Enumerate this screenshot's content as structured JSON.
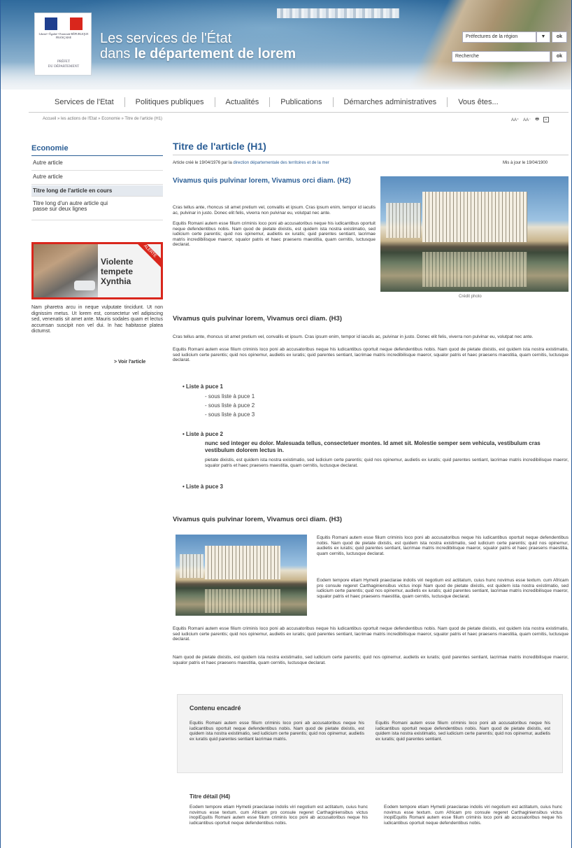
{
  "header": {
    "logo_rf": "Liberté • Égalité • Fraternité RÉPUBLIQUE FRANÇAISE",
    "logo_pref_line1": "PRÉFET",
    "logo_pref_line2": "DU DÉPARTEMENT",
    "title_line1": "Les services de l'État",
    "title_line2_prefix": "dans ",
    "title_line2_bold": "le département de lorem",
    "pref_select_value": "Préfectures de la région",
    "pref_ok": "ok",
    "search_placeholder": "Recherche",
    "search_ok": "ok"
  },
  "nav": [
    "Services de l'Etat",
    "Politiques publiques",
    "Actualités",
    "Publications",
    "Démarches administratives",
    "Vous êtes..."
  ],
  "breadcrumb": "Accueil » les actions de l'Etat » Economie » Titre de l'article (H1)",
  "tools": {
    "font_bigger": "AA⁺",
    "font_smaller": "AA⁻",
    "print_icon": "🖶",
    "share_icon": "+"
  },
  "sidebar": {
    "title": "Economie",
    "items": [
      "Autre article",
      "Autre article",
      "Titre long de l'article en cours",
      "Titre long d'un autre article qui passe sur deux lignes"
    ],
    "banner_line1": "Violente",
    "banner_line2": "tempete",
    "banner_line3": "Xynthia",
    "banner_ribbon": "ALERTE",
    "text": "Nam pharetra arcu in neque vulputate tincidunt. Ut non dignissim metus. Ut lorem est, consectetur vel adipiscing sed, venenatis sit amet ante. Mauris sodales quam et lectus accumsan suscipit non vel dui. In hac habitasse platea dictumst.",
    "link": "> Voir l'article"
  },
  "article": {
    "h1": "Titre de l'article (H1)",
    "meta_prefix": "Article créé le 19/04/1976 par la ",
    "meta_link": "direction départementale des territoires et de la mer",
    "updated": "Mis à jour le 19/04/1900",
    "h2": "Vivamus quis pulvinar lorem, Vivamus orci diam. (H2)",
    "p1": "Cras tellus ante, rhoncus sit amet pretium vel, convallis et ipsum. Cras ipsum enim, tempor id iaculis ac, pulvinar in justo. Donec elit felis, viverra non pulvinar eu, volutpat nec ante.",
    "p2": "Equitis Romani autem esse filium criminis loco poni ab accusatoribus neque his iudicantibus oportuit neque defendentibus nobis. Nam quod de pietate dixistis, est quidem ista nostra existimatio, sed iudicium certe parentis; quid nos opinemur, audietis ex iuratis; quid parentes sentiant, lacrimae matris incredibilisque maeror, squalor patris et haec praesens maestitia, quam cernitis, luctusque declarat.",
    "photo_credit": "Crédit photo",
    "h3a": "Vivamus quis pulvinar lorem, Vivamus orci diam. (H3)",
    "p3": "Cras tellus ante, rhoncus sit amet pretium vel, convallis et ipsum. Cras ipsum enim, tempor id iaculis ac, pulvinar in justo. Donec elit felis, viverra non pulvinar eu, volutpat nec ante.",
    "p4": "Equitis Romani autem esse filium criminis loco poni ab accusatoribus neque his iudicantibus oportuit neque defendentibus nobis. Nam quod de pietate dixistis, est quidem ista nostra existimatio, sed iudicium certe parentis; quid nos opinemur, audietis ex iuratis; quid parentes sentiant, lacrimae matris incredibilisque maeror, squalor patris et haec praesens maestitia, quam cernitis, luctusque declarat.",
    "list1": "• Liste à puce 1",
    "sub1": "- sous liste à puce 1",
    "sub2": "- sous liste à puce 2",
    "sub3": "- sous liste à puce 3",
    "list2": "• Liste à puce 2",
    "list2_bold": "nunc sed integer eu dolor. Malesuada tellus, consectetuer montes. Id amet sit. Molestie semper sem vehicula, vestibulum cras vestibulum dolorem lectus in.",
    "list2_text": "pietate dixistis, est quidem ista nostra existimatio, sed iudicium certe parentis; quid nos opinemur, audietis ex iuratis; quid parentes sentiant, lacrimae matris incredibilisque maeror, squalor patris et haec praesens maestitia, quam cernitis, luctusque declarat.",
    "list3": "• Liste à puce 3",
    "h3b": "Vivamus quis pulvinar lorem, Vivamus orci diam. (H3)",
    "p5": "Equitis Romani autem esse filium criminis loco poni ab accusatoribus neque his iudicantibus oportuit neque defendentibus nobis. Nam quod de pietate dixistis, est quidem ista nostra existimatio, sed iudicium certe parentis; quid nos opinemur, audietis ex iuratis; quid parentes sentiant, lacrimae matris incredibilisque maeror, squalor patris et haec praesens maestitia, quam cernitis, luctusque declarat.",
    "p6": "Eodem tempore etiam Hymetii praeclarae indolis viri negotium est actitatum, cuius hunc novimus esse textum. cum Africam pro consule regeret Carthaginiensibus victus inopi Nam quod de pietate dixistis, est quidem ista nostra existimatio, sed iudicium certe parentis; quid nos opinemur, audietis ex iuratis; quid parentes sentiant, lacrimae matris incredibilisque maeror, squalor patris et haec praesens maestitia, quam cernitis, luctusque declarat.",
    "p7": "Equitis Romani autem esse filium criminis loco poni ab accusatoribus neque his iudicantibus oportuit neque defendentibus nobis. Nam quod de pietate dixistis, est quidem ista nostra existimatio, sed iudicium certe parentis; quid nos opinemur, audietis ex iuratis; quid parentes sentiant, lacrimae matris incredibilisque maeror, squalor patris et haec praesens maestitia, quam cernitis, luctusque declarat.",
    "p8": "Nam quod de pietate dixistis, est quidem ista nostra existimatio, sed iudicium certe parentis; quid nos opinemur, audietis ex iuratis; quid parentes sentiant, lacrimae matris incredibilisque maeror, squalor patris et haec praesens maestitia, quam cernitis, luctusque declarat.",
    "encadre_title": "Contenu encadré",
    "encadre_col1": "Equitis Romani autem esse filium criminis loco poni ab accusatoribus neque his iudicantibus oportuit neque defendentibus nobis. Nam quod de pietate dixistis, est quidem ista nostra existimatio, sed iudicium certe parentis; quid nos opinemur, audietis ex iuratis quid parentes sentiant lacrimae matris.",
    "encadre_col2": "Equitis Romani autem esse filium criminis loco poni ab accusatoribus neque his iudicantibus oportuit neque defendentibus nobis. Nam quod de pietate dixistis, est quidem ista nostra existimatio, sed iudicium certe parentis; quid nos opinemur, audietis ex iuratis; quid parentes sentiant.",
    "h4": "Titre détail (H4)",
    "h4_col1": "Eodem tempore etiam Hymetii praeclarae indolis viri negotium est actitatum, cuius hunc novimus esse textum. cum Africam pro consule regeret Carthaginiensibus victus inopiEquitis Romani autem esse filium criminis loco poni ab accusatoribus neque his iudicantibus oportuit neque defendentibus nobis.",
    "h4_col2": "Eodem tempore etiam Hymetii praeclarae indolis viri negotium est actitatum, cuius hunc novimus esse textum. cum Africam pro consule regeret Carthaginiensibus victus inopiEquitis Romani autem esse filium criminis loco poni ab accusatoribus neque his iudicantibus oportuit neque defendentibus nobis."
  },
  "colors": {
    "accent": "#2a5d95",
    "alert": "#d9261c",
    "flag_blue": "#1f3f8f",
    "flag_red": "#d9261c"
  }
}
